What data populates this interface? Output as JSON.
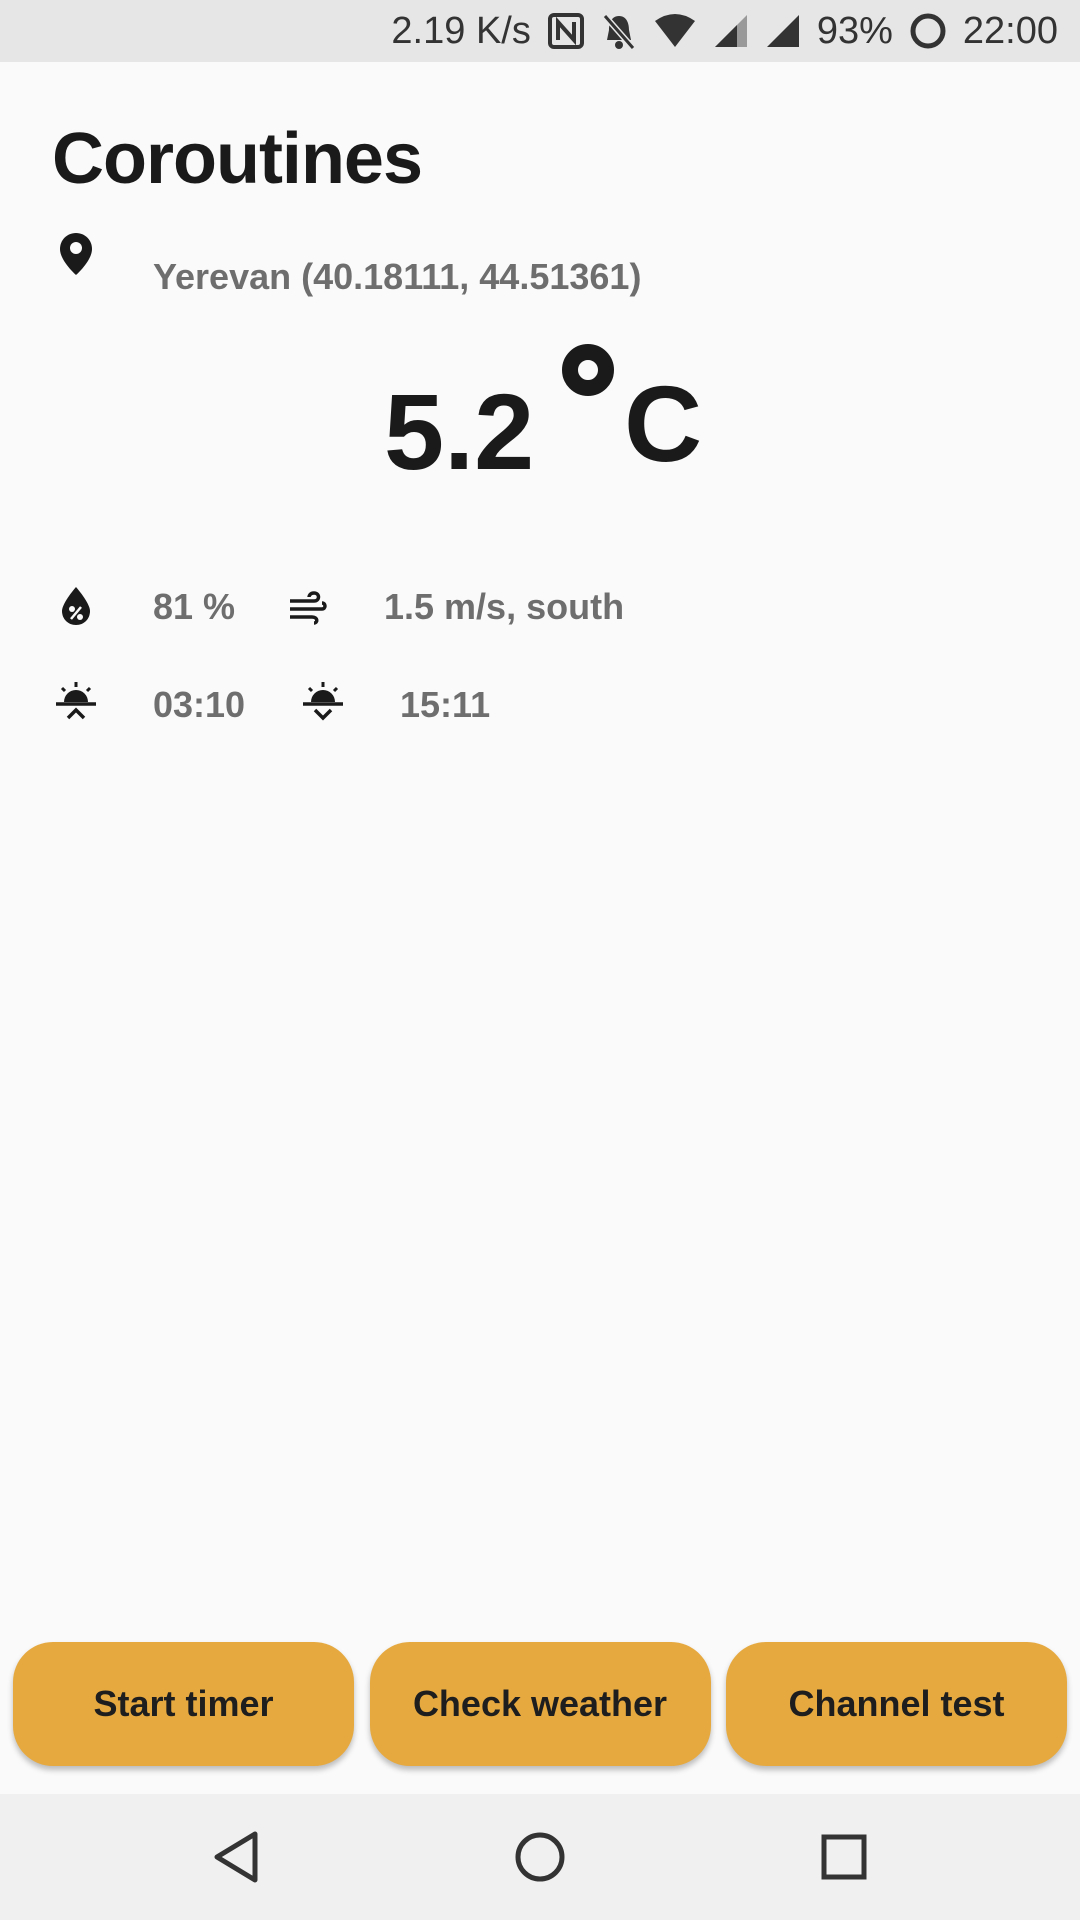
{
  "status_bar": {
    "net_speed": "2.19 K/s",
    "battery": "93%",
    "time": "22:00"
  },
  "app": {
    "title": "Coroutines"
  },
  "location": {
    "icon": "location-pin-icon",
    "text": "Yerevan (40.18111, 44.51361)"
  },
  "weather": {
    "temperature": "5.2",
    "unit": "C",
    "humidity": "81 %",
    "wind": "1.5 m/s, south",
    "sunrise": "03:10",
    "sunset": "15:11"
  },
  "buttons": {
    "start_timer": "Start timer",
    "check_weather": "Check weather",
    "channel_test": "Channel test"
  },
  "colors": {
    "button_bg": "#e6a940",
    "background": "#fafafa"
  }
}
